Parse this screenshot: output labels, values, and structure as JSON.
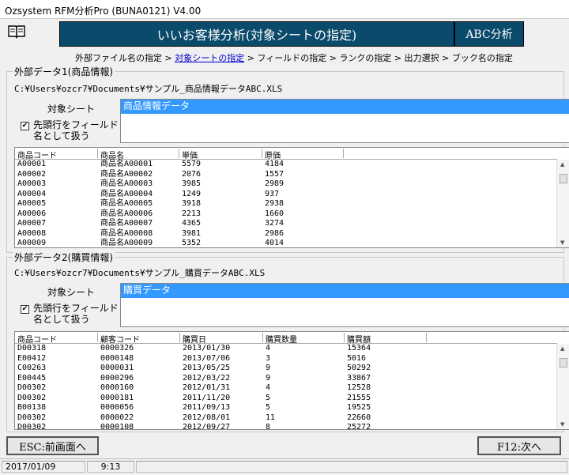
{
  "window": {
    "title": "Ozsystem RFM分析Pro (BUNA0121)   V4.00"
  },
  "header": {
    "title": "いいお客様分析(対象シートの指定)",
    "abc_button": "ABC分析"
  },
  "steps": {
    "s1": "外部ファイル名の指定",
    "sep": " > ",
    "s2": "対象シートの指定",
    "s3": "フィールドの指定",
    "s4": "ランクの指定",
    "s5": "出力選択",
    "s6": "ブック名の指定"
  },
  "group1": {
    "legend": "外部データ1(商品情報)",
    "path": "C:¥Users¥ozcr7¥Documents¥サンプル_商品情報データABC.XLS",
    "sheet_label": "対象シート",
    "sheet_selected": "商品情報データ",
    "checkbox_label": "先頭行をフィールド名として扱う",
    "checkbox_mark": "✔",
    "columns": [
      "商品コード",
      "商品名",
      "単価",
      "原価"
    ],
    "rows": [
      [
        "A00001",
        "商品名A00001",
        "5579",
        "4184"
      ],
      [
        "A00002",
        "商品名A00002",
        "2076",
        "1557"
      ],
      [
        "A00003",
        "商品名A00003",
        "3985",
        "2989"
      ],
      [
        "A00004",
        "商品名A00004",
        "1249",
        "937"
      ],
      [
        "A00005",
        "商品名A00005",
        "3918",
        "2938"
      ],
      [
        "A00006",
        "商品名A00006",
        "2213",
        "1660"
      ],
      [
        "A00007",
        "商品名A00007",
        "4365",
        "3274"
      ],
      [
        "A00008",
        "商品名A00008",
        "3981",
        "2986"
      ],
      [
        "A00009",
        "商品名A00009",
        "5352",
        "4014"
      ]
    ]
  },
  "group2": {
    "legend": "外部データ2(購買情報)",
    "path": "C:¥Users¥ozcr7¥Documents¥サンプル_購買データABC.XLS",
    "sheet_label": "対象シート",
    "sheet_selected": "購買データ",
    "checkbox_label": "先頭行をフィールド名として扱う",
    "checkbox_mark": "✔",
    "columns": [
      "商品コード",
      "顧客コード",
      "購買日",
      "購買数量",
      "購買額"
    ],
    "rows": [
      [
        "D00318",
        "0000326",
        "2013/01/30",
        "4",
        "15364"
      ],
      [
        "E00412",
        "0000148",
        "2013/07/06",
        "3",
        "5016"
      ],
      [
        "C00263",
        "0000031",
        "2013/05/25",
        "9",
        "50292"
      ],
      [
        "E00445",
        "0000296",
        "2012/03/22",
        "9",
        "33867"
      ],
      [
        "D00302",
        "0000160",
        "2012/01/31",
        "4",
        "12528"
      ],
      [
        "D00302",
        "0000181",
        "2011/11/20",
        "5",
        "21555"
      ],
      [
        "B00138",
        "0000056",
        "2011/09/13",
        "5",
        "19525"
      ],
      [
        "D00302",
        "0000022",
        "2012/08/01",
        "11",
        "22660"
      ],
      [
        "D00302",
        "0000108",
        "2012/09/27",
        "8",
        "25272"
      ]
    ]
  },
  "footer": {
    "back_button": "ESC:前画面へ",
    "next_button": "F12:次へ"
  },
  "status": {
    "date": "2017/01/09",
    "time": "9:13"
  }
}
